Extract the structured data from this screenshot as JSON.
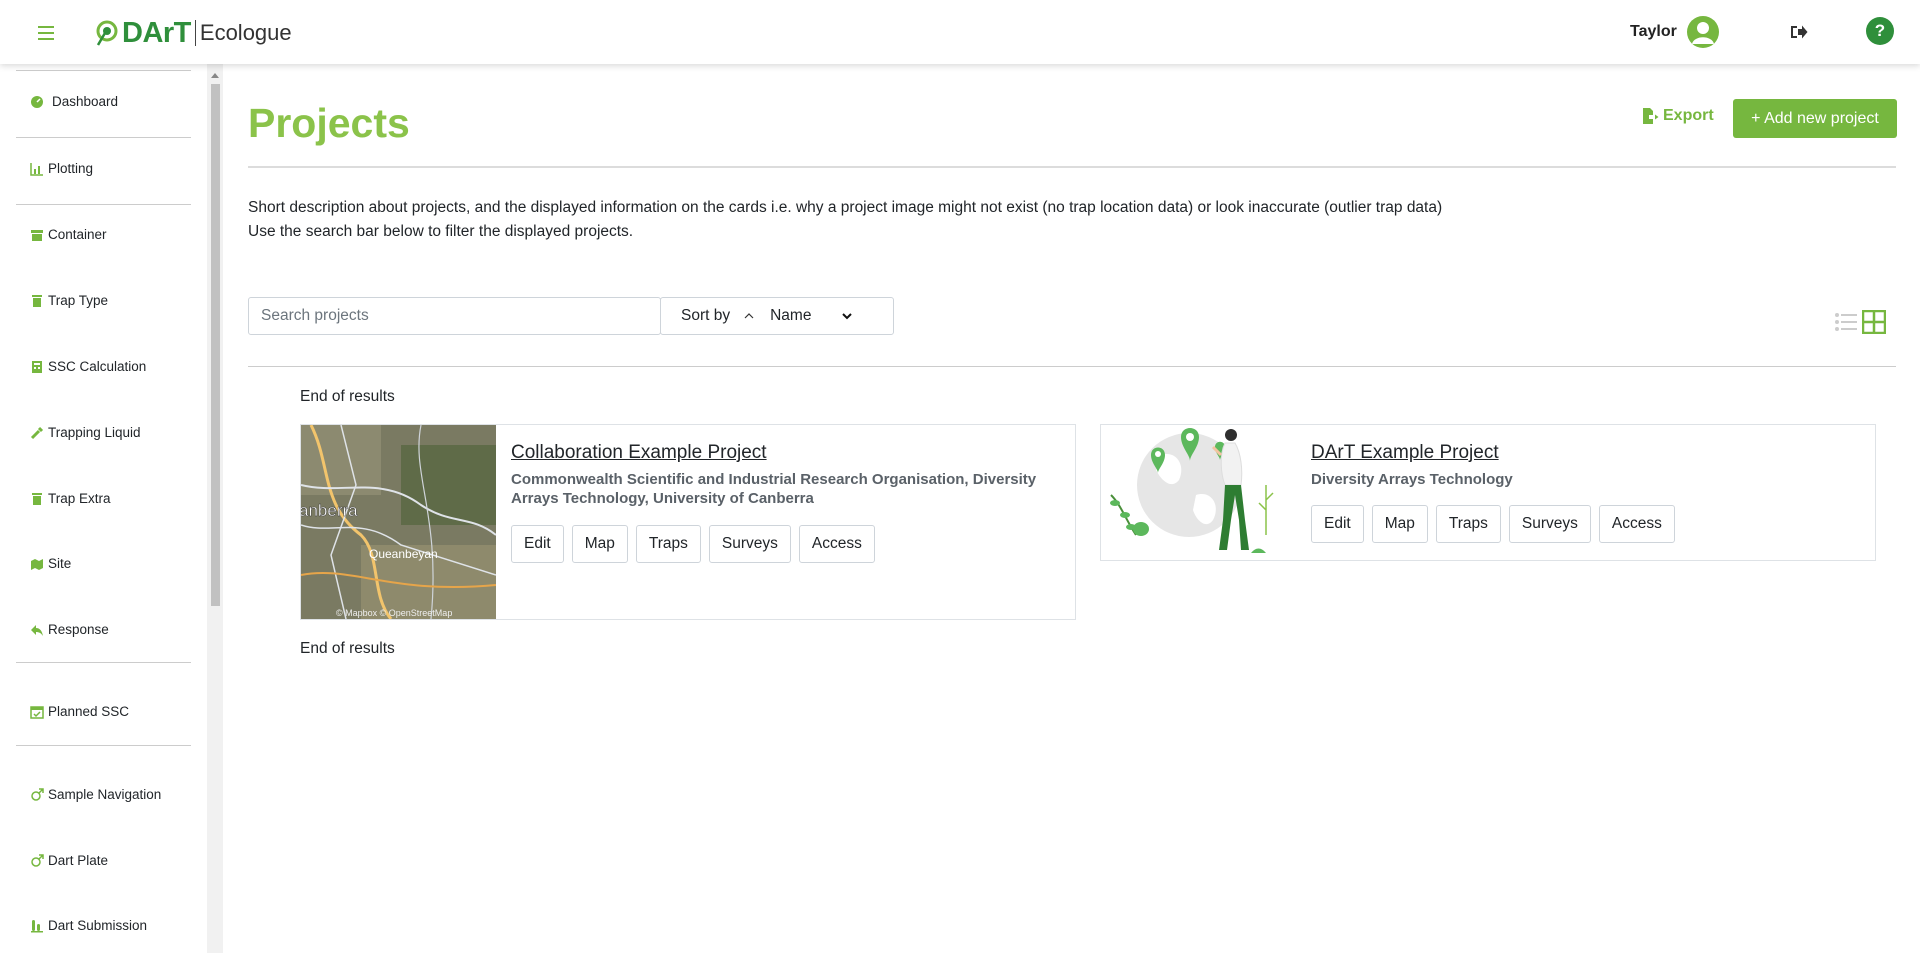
{
  "header": {
    "logo_dart": "DArT",
    "logo_app": "Ecologue",
    "user_name": "Taylor",
    "help": "?"
  },
  "sidebar": {
    "items": [
      {
        "label": "Dashboard",
        "icon": "dashboard-icon"
      },
      {
        "label": "Plotting",
        "icon": "plot-icon"
      },
      {
        "label": "Container",
        "icon": "container-icon"
      },
      {
        "label": "Trap Type",
        "icon": "trash-icon"
      },
      {
        "label": "SSC Calculation",
        "icon": "calculator-icon"
      },
      {
        "label": "Trapping Liquid",
        "icon": "pipette-icon"
      },
      {
        "label": "Trap Extra",
        "icon": "trash-icon"
      },
      {
        "label": "Site",
        "icon": "map-icon"
      },
      {
        "label": "Response",
        "icon": "reply-icon"
      },
      {
        "label": "Planned SSC",
        "icon": "calendar-check-icon"
      },
      {
        "label": "Sample Navigation",
        "icon": "mars-icon"
      },
      {
        "label": "Dart Plate",
        "icon": "mars-icon"
      },
      {
        "label": "Dart Submission",
        "icon": "vials-icon"
      }
    ]
  },
  "main": {
    "title": "Projects",
    "export_label": "Export",
    "add_label": "+ Add new project",
    "description_line1": "Short description about projects, and the displayed information on the cards i.e. why a project image might not exist (no trap location data) or look inaccurate (outlier trap data)",
    "description_line2": "Use the search bar below to filter the displayed projects.",
    "search_placeholder": "Search projects",
    "sort_label": "Sort by",
    "sort_value": "Name",
    "end_of_results": "End of results",
    "projects": [
      {
        "title": "Collaboration Example Project",
        "orgs_line1": "Commonwealth Scientific and Industrial Research Organisation, Diversity",
        "orgs_line2": "Arrays Technology, University of Canberra",
        "map_labels": [
          "anberra",
          "Queanbeyan",
          "© Mapbox © OpenStreetMap"
        ],
        "buttons": [
          "Edit",
          "Map",
          "Traps",
          "Surveys",
          "Access"
        ]
      },
      {
        "title": "DArT Example Project",
        "orgs_line1": "Diversity Arrays Technology",
        "buttons": [
          "Edit",
          "Map",
          "Traps",
          "Surveys",
          "Access"
        ]
      }
    ]
  },
  "colors": {
    "brand_green": "#76b73f",
    "title_green": "#8bc34a",
    "dark_green": "#2f8f3b"
  }
}
